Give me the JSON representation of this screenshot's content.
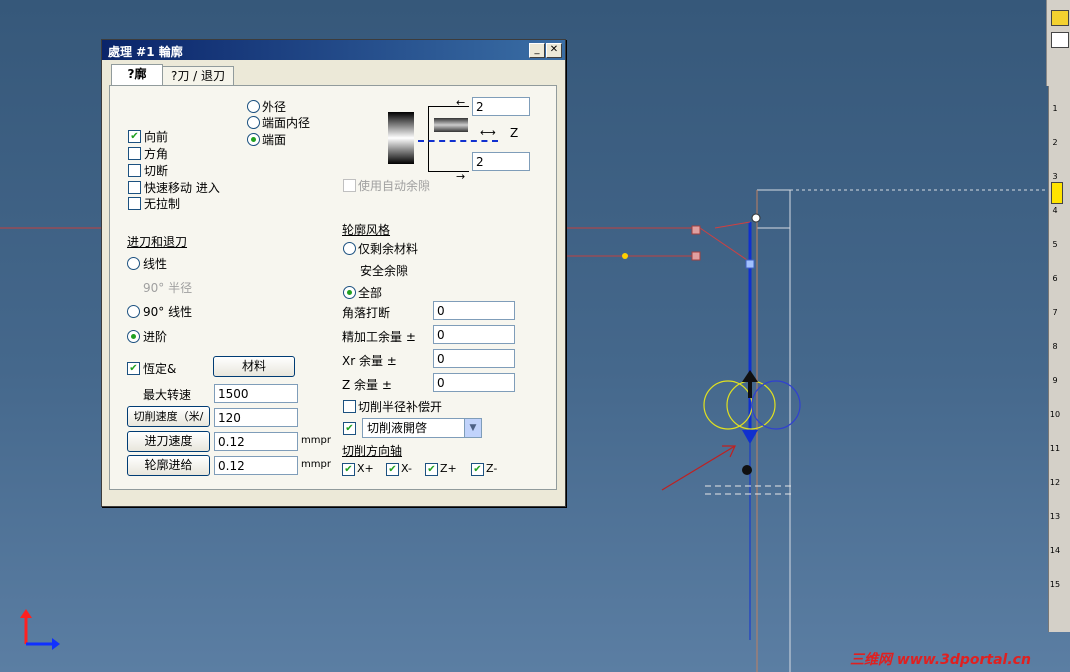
{
  "dialog": {
    "title": "處理 #1 輪廓",
    "tabs": [
      "?廓",
      "?刀 / 退刀"
    ],
    "radio_outer": "外径",
    "radio_inner": "端面内径",
    "radio_face": "端面",
    "forward": "向前",
    "square": "方角",
    "cut": "切断",
    "rapid": "快速移动 进入",
    "no_pull": "无拉制",
    "auto_clearance": "使用自动余隙",
    "diagram_val1": "2",
    "diagram_val2": "2",
    "diagram_z": "Z",
    "lead_section": "进刀和退刀",
    "linear": "线性",
    "radius_90": "90° 半径",
    "linear_90": "90° 线性",
    "feed_in": "进阶",
    "constant": "恆定&",
    "material_btn": "材料",
    "max_speed_label": "最大转速",
    "max_speed": "1500",
    "cut_speed_btn": "切削速度（米/分）",
    "cut_speed": "120",
    "feed_rate_btn": "进刀速度",
    "feed_rate": "0.12",
    "contour_feed_btn": "轮廓进给",
    "contour_feed": "0.12",
    "unit": "mmpr",
    "profile_style": "轮廓风格",
    "remaining_only": "仅剩余材料",
    "safe_clearance": "安全余隙",
    "all": "全部",
    "corner_break_label": "角落打断",
    "corner_break": "0",
    "finish_allow_label": "精加工余量 ±",
    "finish_allow": "0",
    "xr_allow_label": "Xr 余量 ±",
    "xr_allow": "0",
    "z_allow_label": "Z 余量 ±",
    "z_allow": "0",
    "comp_label": "切削半径补偿开",
    "comp_select": "切削液開啓",
    "dir_axis": "切削方向轴",
    "axis_xp": "X+",
    "axis_xm": "X-",
    "axis_zp": "Z+",
    "axis_zm": "Z-"
  },
  "right_tabs": [
    "1",
    "2",
    "3",
    "4",
    "5",
    "6",
    "7",
    "8",
    "9",
    "10",
    "11",
    "12",
    "13",
    "14",
    "15"
  ],
  "watermark": "三维网 www.3dportal.cn",
  "colors": {
    "accent": "#0a246a",
    "toolpath": "#1030d0",
    "check": "#21a121"
  }
}
